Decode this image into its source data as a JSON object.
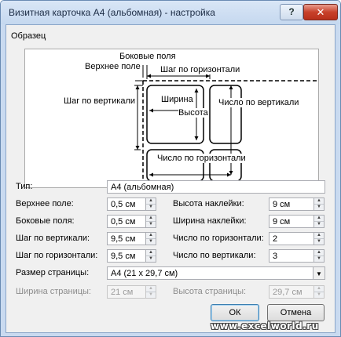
{
  "window": {
    "title": "Визитная карточка А4 (альбомная) - настройка",
    "help_glyph": "?",
    "close_glyph": "✕"
  },
  "preview": {
    "group_label": "Образец",
    "side_margin": "Боковые поля",
    "top_margin": "Верхнее поле",
    "horizontal_pitch": "Шаг по горизонтали",
    "vertical_pitch": "Шаг по вертикали",
    "width": "Ширина",
    "height": "Высота",
    "number_down": "Число по вертикали",
    "number_across": "Число по горизонтали"
  },
  "form": {
    "type_label": "Тип:",
    "type_value": "А4 (альбомная)",
    "top_margin_label": "Верхнее поле:",
    "top_margin_value": "0,5 см",
    "side_margin_label": "Боковые поля:",
    "side_margin_value": "0,5 см",
    "vertical_pitch_label": "Шаг по вертикали:",
    "vertical_pitch_value": "9,5 см",
    "horizontal_pitch_label": "Шаг по горизонтали:",
    "horizontal_pitch_value": "9,5 см",
    "label_height_label": "Высота наклейки:",
    "label_height_value": "9 см",
    "label_width_label": "Ширина наклейки:",
    "label_width_value": "9 см",
    "number_across_label": "Число по горизонтали:",
    "number_across_value": "2",
    "number_down_label": "Число по вертикали:",
    "number_down_value": "3",
    "page_size_label": "Размер страницы:",
    "page_size_value": "A4 (21 x 29,7 см)",
    "page_width_label": "Ширина страницы:",
    "page_width_value": "21 см",
    "page_height_label": "Высота страницы:",
    "page_height_value": "29,7 см"
  },
  "buttons": {
    "ok": "ОК",
    "cancel": "Отмена"
  },
  "watermark": "www.excelworld.ru",
  "icons": {
    "spin_up": "▲",
    "spin_down": "▼",
    "dropdown": "▼"
  }
}
